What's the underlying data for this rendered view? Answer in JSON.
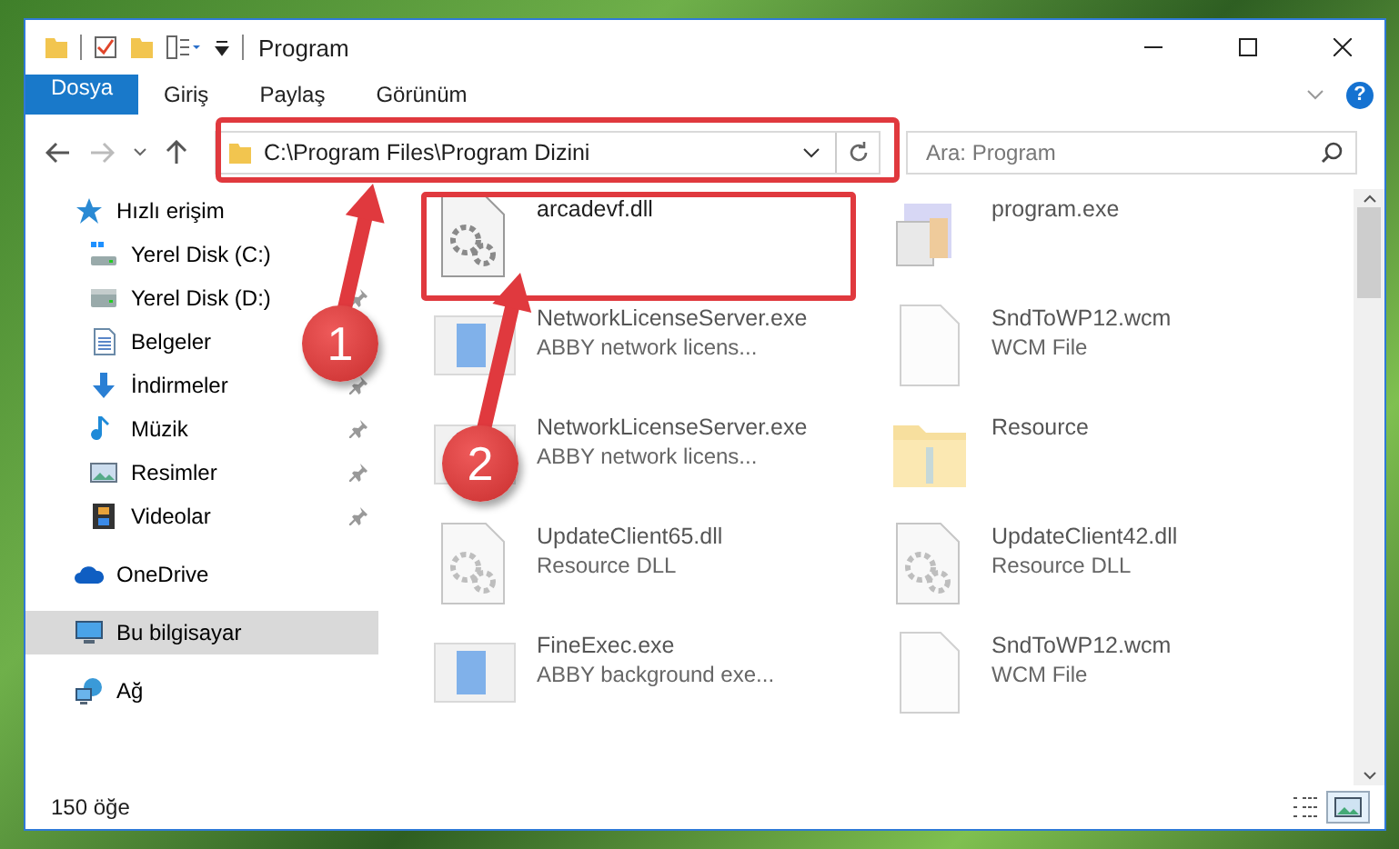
{
  "window": {
    "title": "Program"
  },
  "ribbon": {
    "tabs": [
      {
        "label": "Dosya",
        "kind": "file"
      },
      {
        "label": "Giriş",
        "kind": "tab"
      },
      {
        "label": "Paylaş",
        "kind": "tab"
      },
      {
        "label": "Görünüm",
        "kind": "tab"
      }
    ],
    "help_label": "?"
  },
  "address_bar": {
    "path": "C:\\Program Files\\Program Dizini"
  },
  "search": {
    "placeholder": "Ara: Program"
  },
  "sidebar": {
    "items": [
      {
        "label": "Hızlı erişim",
        "kind": "quick-access",
        "selected": false,
        "children": [
          {
            "label": "Yerel Disk (C:)",
            "kind": "system-drive",
            "selected": false
          },
          {
            "label": "Yerel Disk (D:)",
            "kind": "drive",
            "pinned": true,
            "selected": false
          },
          {
            "label": "Belgeler",
            "kind": "documents",
            "selected": false
          },
          {
            "label": "İndirmeler",
            "kind": "downloads",
            "pinned": true,
            "selected": false
          },
          {
            "label": "Müzik",
            "kind": "music",
            "pinned": true,
            "selected": false
          },
          {
            "label": "Resimler",
            "kind": "pictures",
            "pinned": true,
            "selected": false
          },
          {
            "label": "Videolar",
            "kind": "videos",
            "pinned": true,
            "selected": false
          }
        ]
      },
      {
        "label": "OneDrive",
        "kind": "cloud",
        "selected": false
      },
      {
        "label": "Bu bilgisayar",
        "kind": "computer",
        "selected": true
      },
      {
        "label": "Ağ",
        "kind": "network",
        "selected": false
      }
    ]
  },
  "files": [
    {
      "name": "arcadevf.dll",
      "kind": "dll",
      "blurred": false
    },
    {
      "name": "program.exe",
      "kind": "app",
      "blurred": true
    },
    {
      "name": "NetworkLicenseServer.exe",
      "description": "ABBY network licens...",
      "kind": "exe",
      "blurred": true
    },
    {
      "name": "SndToWP12.wcm",
      "description": "WCM File",
      "kind": "file",
      "blurred": true
    },
    {
      "name": "NetworkLicenseServer.exe",
      "description": "ABBY network licens...",
      "kind": "exe",
      "blurred": true
    },
    {
      "name": "Resource",
      "kind": "folder",
      "blurred": true
    },
    {
      "name": "UpdateClient65.dll",
      "description": "Resource DLL",
      "kind": "dll",
      "blurred": true
    },
    {
      "name": "UpdateClient42.dll",
      "description": "Resource DLL",
      "kind": "dll",
      "blurred": true
    },
    {
      "name": "FineExec.exe",
      "description": "ABBY background exe...",
      "kind": "exe",
      "blurred": true
    },
    {
      "name": "SndToWP12.wcm",
      "description": "WCM File",
      "kind": "file",
      "blurred": true
    }
  ],
  "status_bar": {
    "item_count": "150 öğe"
  },
  "annotations": [
    {
      "label": "1"
    },
    {
      "label": "2"
    }
  ]
}
